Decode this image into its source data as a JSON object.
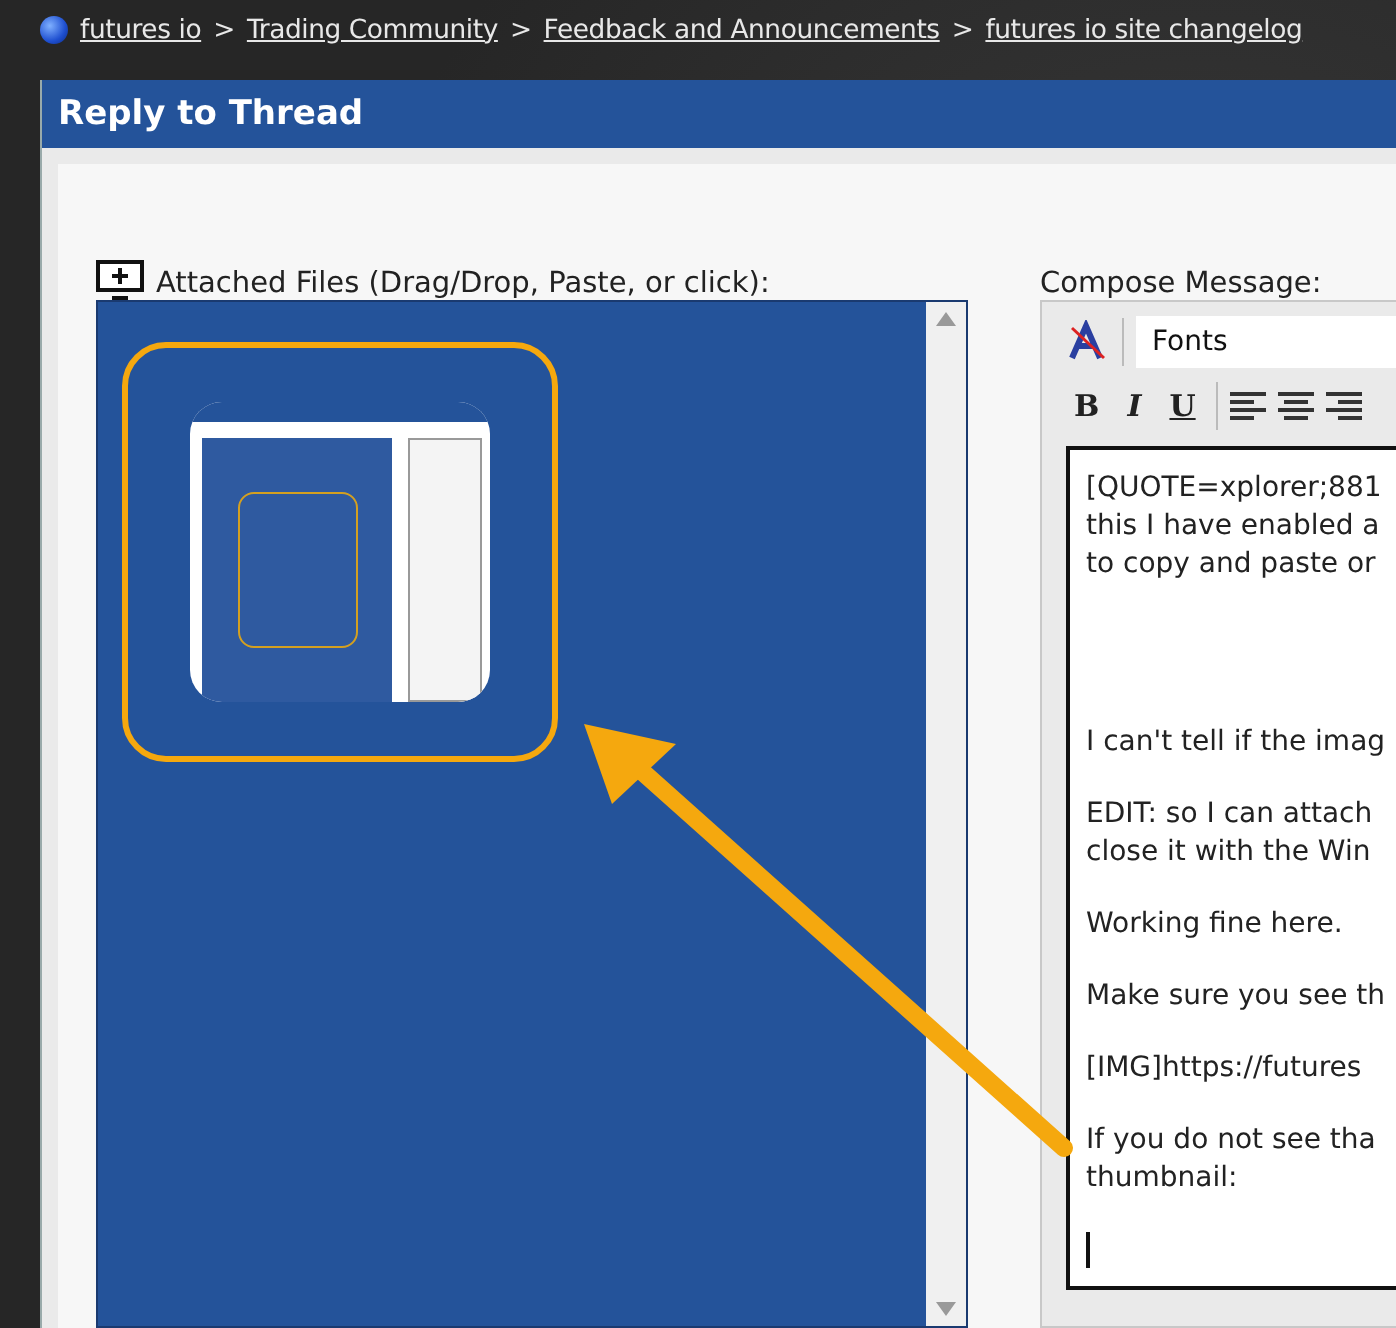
{
  "breadcrumb": [
    {
      "label": "futures io"
    },
    {
      "label": "Trading Community"
    },
    {
      "label": "Feedback and Announcements"
    },
    {
      "label": "futures io site changelog"
    }
  ],
  "breadcrumb_separator": ">",
  "dialog": {
    "title": "Reply to Thread"
  },
  "attachments": {
    "label": "Attached Files (Drag/Drop, Paste, or click):"
  },
  "compose": {
    "label": "Compose Message:",
    "font_select": "Fonts",
    "format_buttons": [
      {
        "label": "B",
        "kind": "bold"
      },
      {
        "label": "I",
        "kind": "italic"
      },
      {
        "label": "U",
        "kind": "underline"
      }
    ],
    "paragraphs": [
      [
        "[QUOTE=xplorer;881",
        "this I have enabled a",
        "to copy and paste or"
      ],
      [
        "I can't tell if the imag"
      ],
      [
        "EDIT: so I can attach",
        "close it with the Win"
      ],
      [
        "Working fine here."
      ],
      [
        "Make sure you see th"
      ],
      [
        "[IMG]https://futures"
      ],
      [
        "If you do not see tha",
        "thumbnail:"
      ]
    ]
  }
}
